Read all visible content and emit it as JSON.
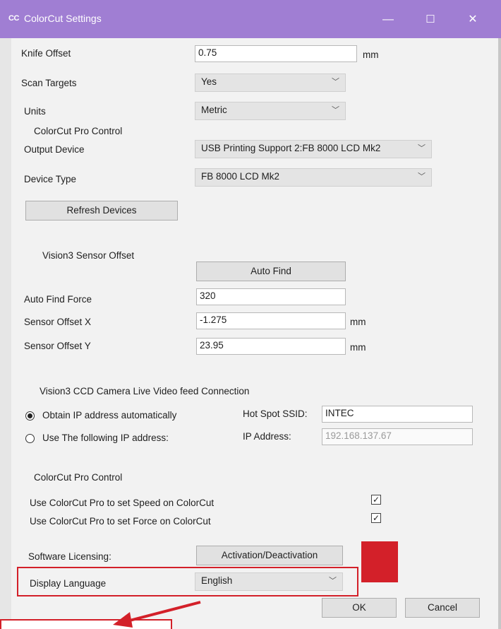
{
  "window": {
    "logo": "CC",
    "title": "ColorCut Settings",
    "minimize": "—",
    "maximize": "☐",
    "close": "✕"
  },
  "general": {
    "knife_offset_label": "Knife Offset",
    "knife_offset_value": "0.75",
    "knife_offset_unit": "mm",
    "scan_targets_label": "Scan Targets",
    "scan_targets_value": "Yes",
    "units_label": "Units",
    "units_value": "Metric"
  },
  "pro_control_1": {
    "heading": "ColorCut Pro Control",
    "output_device_label": "Output Device",
    "output_device_value": "USB Printing Support 2:FB 8000 LCD Mk2",
    "device_type_label": "Device Type",
    "device_type_value": "FB 8000 LCD Mk2",
    "refresh_label": "Refresh Devices"
  },
  "sensor": {
    "heading": "Vision3 Sensor Offset",
    "auto_find_label": "Auto Find",
    "force_label": "Auto Find Force",
    "force_value": "320",
    "offset_x_label": "Sensor Offset X",
    "offset_x_value": "-1.275",
    "offset_x_unit": "mm",
    "offset_y_label": "Sensor Offset Y",
    "offset_y_value": "23.95",
    "offset_y_unit": "mm"
  },
  "camera": {
    "heading": "Vision3 CCD Camera Live Video feed Connection",
    "auto_ip_label": "Obtain IP address automatically",
    "manual_ip_label": "Use The following IP address:",
    "ssid_label": "Hot Spot SSID:",
    "ssid_value": "INTEC",
    "ip_label": "IP Address:",
    "ip_value": "192.168.137.67"
  },
  "pro_control_2": {
    "heading": "ColorCut Pro Control",
    "speed_label": "Use ColorCut Pro to set Speed on ColorCut",
    "force_label": "Use ColorCut Pro to set Force on ColorCut",
    "check_mark": "✓"
  },
  "licensing": {
    "label": "Software Licensing:",
    "button_label": "Activation/Deactivation"
  },
  "language": {
    "label": "Display Language",
    "value": "English"
  },
  "footer": {
    "ok_label": "OK",
    "cancel_label": "Cancel"
  },
  "colors": {
    "titlebar": "#a07ed3",
    "annotation_red": "#d32029"
  }
}
